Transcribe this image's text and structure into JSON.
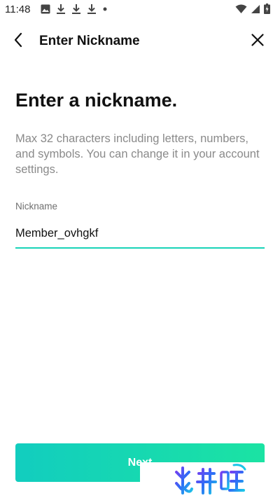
{
  "status_bar": {
    "time": "11:48",
    "left_icons": [
      "image-icon",
      "download-icon",
      "download-icon",
      "download-icon",
      "dot-icon"
    ],
    "right_icons": [
      "wifi-icon",
      "signal-icon",
      "battery-charging-icon"
    ]
  },
  "header": {
    "title": "Enter Nickname",
    "back_icon": "chevron-left-icon",
    "close_icon": "close-icon"
  },
  "main": {
    "headline": "Enter a nickname.",
    "description": "Max 32 characters including letters, numbers, and symbols. You can change it in your account settings.",
    "nickname_field": {
      "label": "Nickname",
      "value": "Member_ovhgkf"
    }
  },
  "footer": {
    "next_label": "Next"
  },
  "theme": {
    "accent_start": "#12cdbf",
    "accent_end": "#1be3a3",
    "underline": "#19d3b8"
  }
}
